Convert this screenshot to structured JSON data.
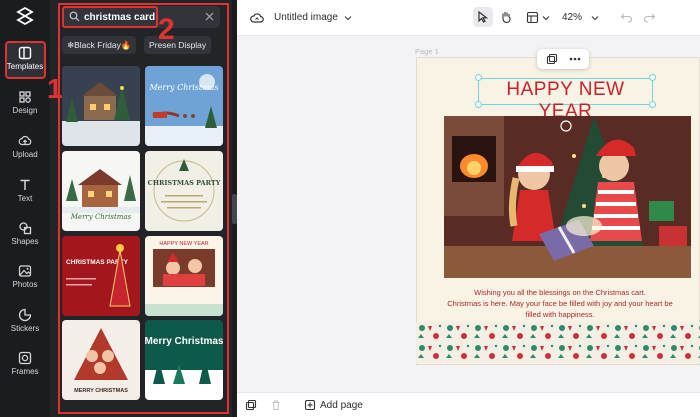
{
  "rail": {
    "items": [
      {
        "label": "Templates",
        "icon": "templates-icon",
        "active": true
      },
      {
        "label": "Design",
        "icon": "design-icon"
      },
      {
        "label": "Upload",
        "icon": "upload-icon"
      },
      {
        "label": "Text",
        "icon": "text-icon"
      },
      {
        "label": "Shapes",
        "icon": "shapes-icon"
      },
      {
        "label": "Photos",
        "icon": "photos-icon"
      },
      {
        "label": "Stickers",
        "icon": "stickers-icon"
      },
      {
        "label": "Frames",
        "icon": "frames-icon"
      }
    ]
  },
  "panel": {
    "search_value": "christmas card",
    "chips": [
      "❄Black Friday🔥",
      "Presen Display"
    ],
    "templates": [
      {
        "name": "cozy-christmas-house"
      },
      {
        "name": "merry-christmas-sleigh",
        "text": "Merry Christmas"
      },
      {
        "name": "merry-christmas-cabin",
        "text": "Merry Christmas"
      },
      {
        "name": "christmas-party-invite",
        "text": "CHRISTMAS PARTY"
      },
      {
        "name": "christmas-party-red",
        "text": "CHRISTMAS PARTY"
      },
      {
        "name": "happy-new-year-photo",
        "text": "HAPPY NEW YEAR"
      },
      {
        "name": "family-tree-photo",
        "text": "MERRY CHRISTMAS"
      },
      {
        "name": "merry-christmas-green",
        "text": "Merry Christmas"
      }
    ]
  },
  "annotations": {
    "one": "1",
    "two": "2"
  },
  "topbar": {
    "document_title": "Untitled image",
    "zoom": "42%"
  },
  "canvas": {
    "page_label": "Page 1",
    "card_title": "HAPPY NEW YEAR",
    "message_lines": [
      "Wishing you all the blessings on the Christmas cart.",
      "Christmas is here. May your face be filled with joy and your heart be",
      "filled with happiness."
    ]
  },
  "bottombar": {
    "add_page_label": "Add page"
  },
  "colors": {
    "accent_red": "#e0322f",
    "card_red": "#c8222b",
    "selection": "#70d6d8"
  }
}
